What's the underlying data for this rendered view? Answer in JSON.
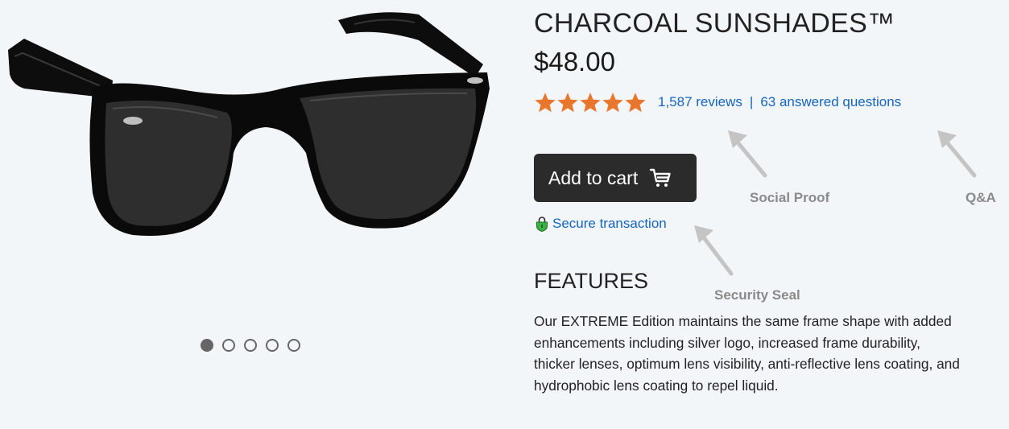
{
  "product": {
    "title": "CHARCOAL SUNSHADES™",
    "price": "$48.00",
    "rating": 5,
    "rating_max": 5,
    "reviews_link": "1,587 reviews",
    "separator": "|",
    "questions_link": "63 answered questions",
    "add_to_cart_label": "Add to cart",
    "secure_label": "Secure transaction",
    "features_heading": "FEATURES",
    "features_text": "Our EXTREME Edition maintains the same frame shape with added enhancements including silver logo, increased frame durability, thicker lenses, optimum lens visibility, anti-reflective lens coating, and hydrophobic lens coating to repel liquid."
  },
  "gallery": {
    "image_icon": "sunglasses-image",
    "dots_total": 5,
    "active_dot": 1
  },
  "annotations": {
    "social_proof": "Social Proof",
    "qa": "Q&A",
    "security_seal": "Security Seal"
  },
  "colors": {
    "background": "#f3f6f9",
    "star": "#e8762d",
    "link": "#1565c0",
    "button": "#2b2b2b",
    "annotation": "#8a8a8a",
    "shield": "#3cb043"
  }
}
